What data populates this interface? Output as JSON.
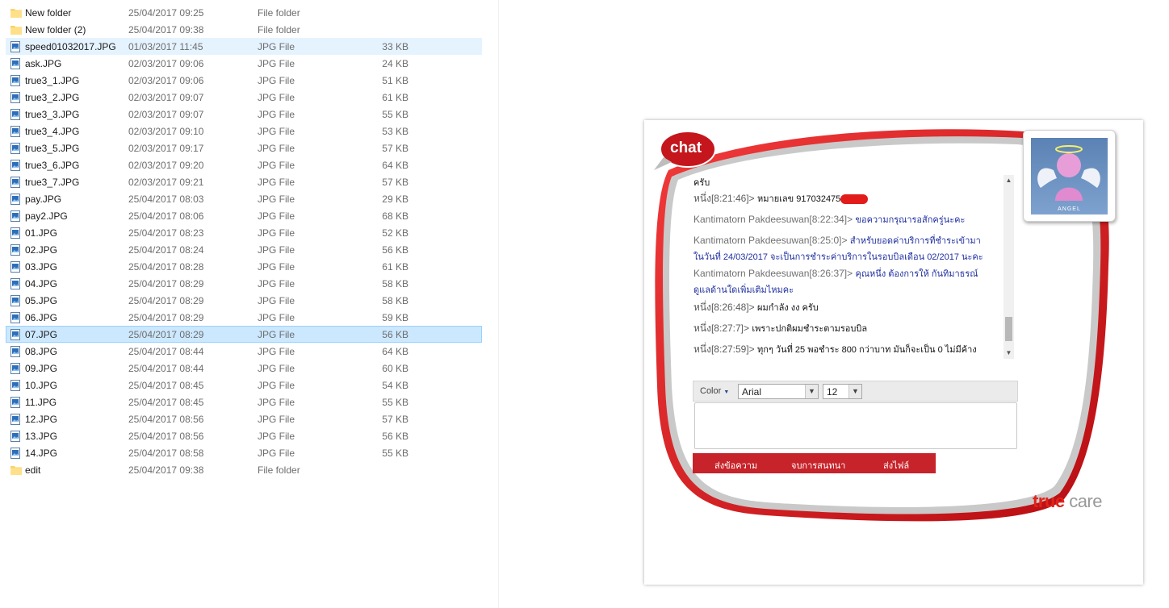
{
  "files": [
    {
      "name": "New folder",
      "date": "25/04/2017 09:25",
      "type": "File folder",
      "size": "",
      "kind": "folder",
      "state": ""
    },
    {
      "name": "New folder (2)",
      "date": "25/04/2017 09:38",
      "type": "File folder",
      "size": "",
      "kind": "folder",
      "state": ""
    },
    {
      "name": "speed01032017.JPG",
      "date": "01/03/2017 11:45",
      "type": "JPG File",
      "size": "33 KB",
      "kind": "image",
      "state": "hover"
    },
    {
      "name": "ask.JPG",
      "date": "02/03/2017 09:06",
      "type": "JPG File",
      "size": "24 KB",
      "kind": "image",
      "state": ""
    },
    {
      "name": "true3_1.JPG",
      "date": "02/03/2017 09:06",
      "type": "JPG File",
      "size": "51 KB",
      "kind": "image",
      "state": ""
    },
    {
      "name": "true3_2.JPG",
      "date": "02/03/2017 09:07",
      "type": "JPG File",
      "size": "61 KB",
      "kind": "image",
      "state": ""
    },
    {
      "name": "true3_3.JPG",
      "date": "02/03/2017 09:07",
      "type": "JPG File",
      "size": "55 KB",
      "kind": "image",
      "state": ""
    },
    {
      "name": "true3_4.JPG",
      "date": "02/03/2017 09:10",
      "type": "JPG File",
      "size": "53 KB",
      "kind": "image",
      "state": ""
    },
    {
      "name": "true3_5.JPG",
      "date": "02/03/2017 09:17",
      "type": "JPG File",
      "size": "57 KB",
      "kind": "image",
      "state": ""
    },
    {
      "name": "true3_6.JPG",
      "date": "02/03/2017 09:20",
      "type": "JPG File",
      "size": "64 KB",
      "kind": "image",
      "state": ""
    },
    {
      "name": "true3_7.JPG",
      "date": "02/03/2017 09:21",
      "type": "JPG File",
      "size": "57 KB",
      "kind": "image",
      "state": ""
    },
    {
      "name": "pay.JPG",
      "date": "25/04/2017 08:03",
      "type": "JPG File",
      "size": "29 KB",
      "kind": "image",
      "state": ""
    },
    {
      "name": "pay2.JPG",
      "date": "25/04/2017 08:06",
      "type": "JPG File",
      "size": "68 KB",
      "kind": "image",
      "state": ""
    },
    {
      "name": "01.JPG",
      "date": "25/04/2017 08:23",
      "type": "JPG File",
      "size": "52 KB",
      "kind": "image",
      "state": ""
    },
    {
      "name": "02.JPG",
      "date": "25/04/2017 08:24",
      "type": "JPG File",
      "size": "56 KB",
      "kind": "image",
      "state": ""
    },
    {
      "name": "03.JPG",
      "date": "25/04/2017 08:28",
      "type": "JPG File",
      "size": "61 KB",
      "kind": "image",
      "state": ""
    },
    {
      "name": "04.JPG",
      "date": "25/04/2017 08:29",
      "type": "JPG File",
      "size": "58 KB",
      "kind": "image",
      "state": ""
    },
    {
      "name": "05.JPG",
      "date": "25/04/2017 08:29",
      "type": "JPG File",
      "size": "58 KB",
      "kind": "image",
      "state": ""
    },
    {
      "name": "06.JPG",
      "date": "25/04/2017 08:29",
      "type": "JPG File",
      "size": "59 KB",
      "kind": "image",
      "state": ""
    },
    {
      "name": "07.JPG",
      "date": "25/04/2017 08:29",
      "type": "JPG File",
      "size": "56 KB",
      "kind": "image",
      "state": "selected"
    },
    {
      "name": "08.JPG",
      "date": "25/04/2017 08:44",
      "type": "JPG File",
      "size": "64 KB",
      "kind": "image",
      "state": ""
    },
    {
      "name": "09.JPG",
      "date": "25/04/2017 08:44",
      "type": "JPG File",
      "size": "60 KB",
      "kind": "image",
      "state": ""
    },
    {
      "name": "10.JPG",
      "date": "25/04/2017 08:45",
      "type": "JPG File",
      "size": "54 KB",
      "kind": "image",
      "state": ""
    },
    {
      "name": "11.JPG",
      "date": "25/04/2017 08:45",
      "type": "JPG File",
      "size": "55 KB",
      "kind": "image",
      "state": ""
    },
    {
      "name": "12.JPG",
      "date": "25/04/2017 08:56",
      "type": "JPG File",
      "size": "57 KB",
      "kind": "image",
      "state": ""
    },
    {
      "name": "13.JPG",
      "date": "25/04/2017 08:56",
      "type": "JPG File",
      "size": "56 KB",
      "kind": "image",
      "state": ""
    },
    {
      "name": "14.JPG",
      "date": "25/04/2017 08:58",
      "type": "JPG File",
      "size": "55 KB",
      "kind": "image",
      "state": ""
    },
    {
      "name": "edit",
      "date": "25/04/2017 09:38",
      "type": "File folder",
      "size": "",
      "kind": "folder",
      "state": ""
    }
  ],
  "chat": {
    "badge": "chat",
    "avatar_label": "ANGEL",
    "messages": {
      "m0": "ครับ",
      "m1_sender": "หนึ่ง[8:21:46]>",
      "m1_text": "หมายเลข 917032475",
      "m2_sender": "Kantimatorn Pakdeesuwan[8:22:34]>",
      "m2_text": "ขอความกรุณารอสักครู่นะคะ",
      "m3_sender": "Kantimatorn Pakdeesuwan[8:25:0]>",
      "m3_text_a": "สำหรับยอดค่าบริการที่ชำระเข้ามา",
      "m3_text_b": "ในวันที่ 24/03/2017 จะเป็นการชำระค่าบริการในรอบบิลเดือน 02/2017 นะคะ",
      "m4_sender": "Kantimatorn Pakdeesuwan[8:26:37]>",
      "m4_text_a": "คุณหนึ่ง ต้องการให้ กันทิมาธรณ์",
      "m4_text_b": "ดูแลด้านใดเพิ่มเติมไหมคะ",
      "m5_sender": "หนึ่ง[8:26:48]>",
      "m5_text": "ผมกำลัง งง ครับ",
      "m6_sender": "หนึ่ง[8:27:7]>",
      "m6_text": "เพราะปกติผมชำระตามรอบบิล",
      "m7_sender": "หนึ่ง[8:27:59]>",
      "m7_text": "ทุกๆ วันที่ 25 พอชำระ 800 กว่าบาท มันก็จะเป็น 0 ไม่มีค้าง"
    },
    "toolbar": {
      "color_label": "Color",
      "font": "Arial",
      "size": "12"
    },
    "input_value": "",
    "actions": {
      "send": "ส่งข้อความ",
      "end": "จบการสนทนา",
      "file": "ส่งไฟล์"
    },
    "brand_a": "true",
    "brand_b": "care",
    "colors": {
      "frame_red": "#d7141a",
      "button_red": "#c6232a",
      "text_blue": "#1e2fa0"
    }
  }
}
